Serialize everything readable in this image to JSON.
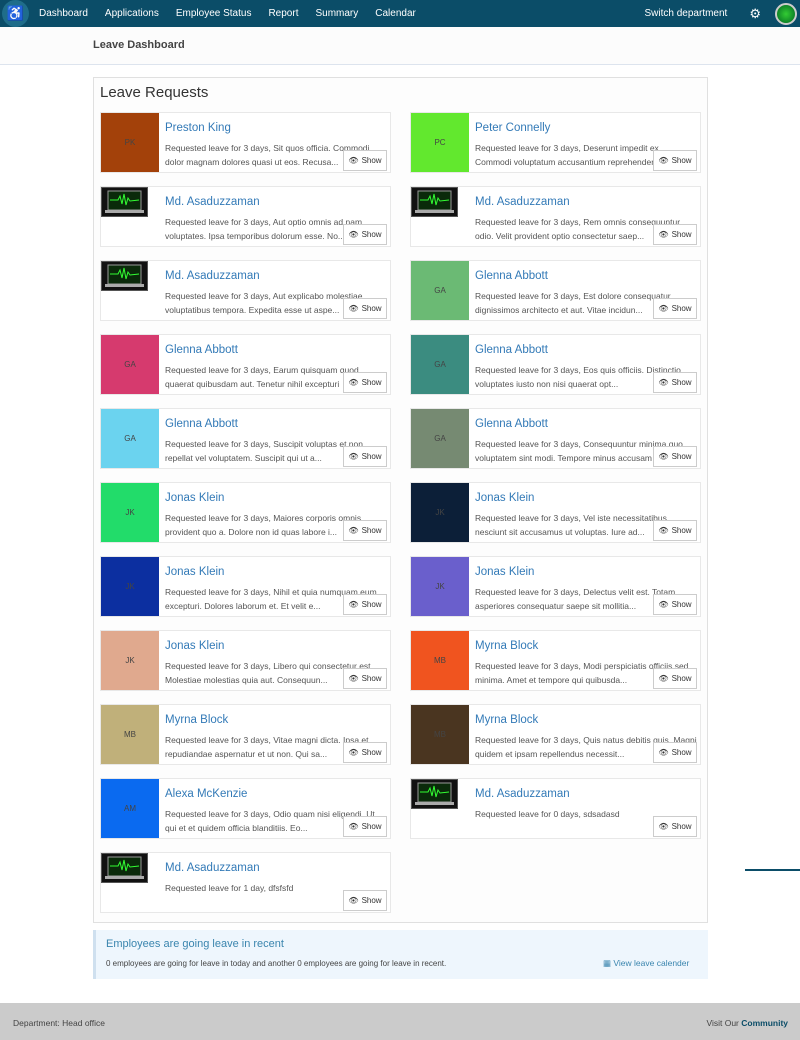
{
  "nav": {
    "items": [
      "Dashboard",
      "Applications",
      "Employee Status",
      "Report",
      "Summary",
      "Calendar"
    ],
    "switch": "Switch department"
  },
  "page_title": "Leave Dashboard",
  "panel_title": "Leave Requests",
  "show_label": "Show",
  "cards": [
    {
      "name": "Preston King",
      "initials": "PK",
      "color": "#a3410a",
      "desc": "Requested leave for 3 days, Sit quos officia. Commodi dolor magnam dolores quasi ut eos. Recusa..."
    },
    {
      "name": "Peter Connelly",
      "initials": "PC",
      "color": "#62e82e",
      "desc": "Requested leave for 3 days, Deserunt impedit ex. Commodi voluptatum accusantium reprehenderit"
    },
    {
      "name": "Md. Asaduzzaman",
      "initials": "",
      "color": "",
      "desc": "Requested leave for 3 days, Aut optio omnis ad nam voluptates. Ipsa temporibus dolorum esse. No..."
    },
    {
      "name": "Md. Asaduzzaman",
      "initials": "",
      "color": "",
      "desc": "Requested leave for 3 days, Rem omnis consequuntur odio. Velit provident optio consectetur saep..."
    },
    {
      "name": "Md. Asaduzzaman",
      "initials": "",
      "color": "",
      "desc": "Requested leave for 3 days, Aut explicabo molestiae voluptatibus tempora. Expedita esse ut aspe..."
    },
    {
      "name": "Glenna Abbott",
      "initials": "GA",
      "color": "#6bba74",
      "desc": "Requested leave for 3 days, Est dolore consequatur dignissimos architecto et aut. Vitae incidun..."
    },
    {
      "name": "Glenna Abbott",
      "initials": "GA",
      "color": "#d63a6e",
      "desc": "Requested leave for 3 days, Earum quisquam quod quaerat quibusdam aut. Tenetur nihil excepturi"
    },
    {
      "name": "Glenna Abbott",
      "initials": "GA",
      "color": "#3b8c80",
      "desc": "Requested leave for 3 days, Eos quis officiis. Distinctio voluptates iusto non nisi quaerat opt..."
    },
    {
      "name": "Glenna Abbott",
      "initials": "GA",
      "color": "#6bd3ef",
      "desc": "Requested leave for 3 days, Suscipit voluptas et non repellat vel voluptatem. Suscipit qui ut a..."
    },
    {
      "name": "Glenna Abbott",
      "initials": "GA",
      "color": "#768a72",
      "desc": "Requested leave for 3 days, Consequuntur minima quo voluptatem sint modi. Tempore minus accusam"
    },
    {
      "name": "Jonas Klein",
      "initials": "JK",
      "color": "#22dc6a",
      "desc": "Requested leave for 3 days, Maiores corporis omnis provident quo a. Dolore non id quas labore i..."
    },
    {
      "name": "Jonas Klein",
      "initials": "JK",
      "color": "#0c1f38",
      "desc": "Requested leave for 3 days, Vel iste necessitatibus nesciunt sit accusamus ut voluptas. Iure ad..."
    },
    {
      "name": "Jonas Klein",
      "initials": "JK",
      "color": "#0c2fa0",
      "desc": "Requested leave for 3 days, Nihil et quia numquam eum excepturi. Dolores laborum et. Et velit e..."
    },
    {
      "name": "Jonas Klein",
      "initials": "JK",
      "color": "#6a5fcc",
      "desc": "Requested leave for 3 days, Delectus velit est. Totam asperiores consequatur saepe sit mollitia..."
    },
    {
      "name": "Jonas Klein",
      "initials": "JK",
      "color": "#e0a98e",
      "desc": "Requested leave for 3 days, Libero qui consectetur est. Molestiae molestias quia aut. Consequun..."
    },
    {
      "name": "Myrna Block",
      "initials": "MB",
      "color": "#f0541f",
      "desc": "Requested leave for 3 days, Modi perspiciatis officiis sed minima. Amet et tempore qui quibusda..."
    },
    {
      "name": "Myrna Block",
      "initials": "MB",
      "color": "#c0b07a",
      "desc": "Requested leave for 3 days, Vitae magni dicta. Ipsa et repudiandae aspernatur et ut non. Qui sa..."
    },
    {
      "name": "Myrna Block",
      "initials": "MB",
      "color": "#4a3520",
      "desc": "Requested leave for 3 days, Quis natus debitis quis. Magni quidem et ipsam repellendus necessit..."
    },
    {
      "name": "Alexa McKenzie",
      "initials": "AM",
      "color": "#0a6af0",
      "desc": "Requested leave for 3 days, Odio quam nisi eligendi. Ut qui et et quidem officia blanditiis. Eo..."
    },
    {
      "name": "Md. Asaduzzaman",
      "initials": "",
      "color": "",
      "desc": "Requested leave for 0 days, sdsadasd"
    },
    {
      "name": "Md. Asaduzzaman",
      "initials": "",
      "color": "",
      "desc": "Requested leave for 1 day, dfsfsfd"
    }
  ],
  "recent": {
    "title": "Employees are going leave in recent",
    "text": "0 employees are going for leave in today and another 0 employees are going for leave in recent.",
    "link": "View leave calender"
  },
  "footer": {
    "department": "Department: Head office",
    "visit": "Visit Our",
    "community": "Community"
  }
}
